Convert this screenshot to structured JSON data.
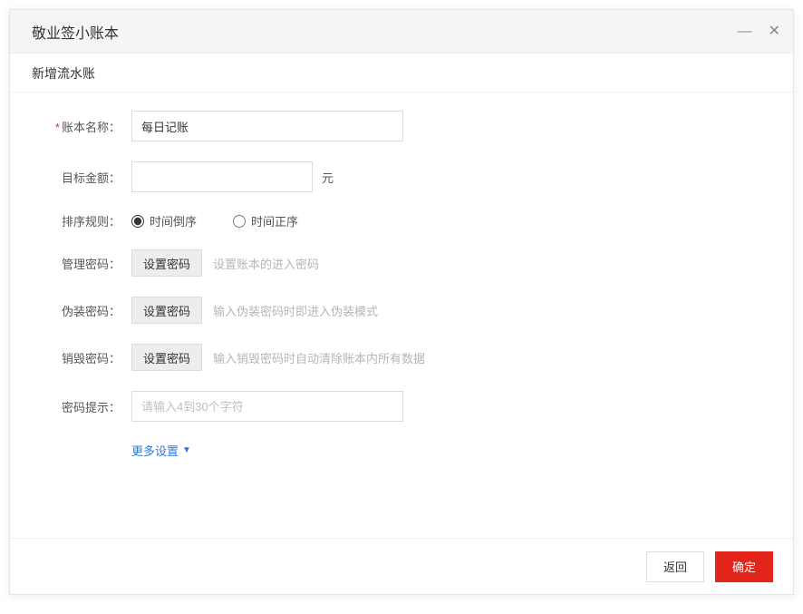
{
  "titlebar": {
    "title": "敬业签小账本"
  },
  "subheader": "新增流水账",
  "form": {
    "name_label": "账本名称：",
    "name_value": "每日记账",
    "target_label": "目标金额：",
    "target_value": "",
    "target_unit": "元",
    "sort_label": "排序规则：",
    "sort_options": {
      "desc": "时间倒序",
      "asc": "时间正序"
    },
    "admin_pw_label": "管理密码：",
    "admin_pw_btn": "设置密码",
    "admin_pw_hint": "设置账本的进入密码",
    "fake_pw_label": "伪装密码：",
    "fake_pw_btn": "设置密码",
    "fake_pw_hint": "输入伪装密码时即进入伪装模式",
    "destroy_pw_label": "销毁密码：",
    "destroy_pw_btn": "设置密码",
    "destroy_pw_hint": "输入销毁密码时自动清除账本内所有数据",
    "pw_hint_label": "密码提示：",
    "pw_hint_placeholder": "请输入4到30个字符",
    "more_settings": "更多设置"
  },
  "footer": {
    "back": "返回",
    "confirm": "确定"
  }
}
